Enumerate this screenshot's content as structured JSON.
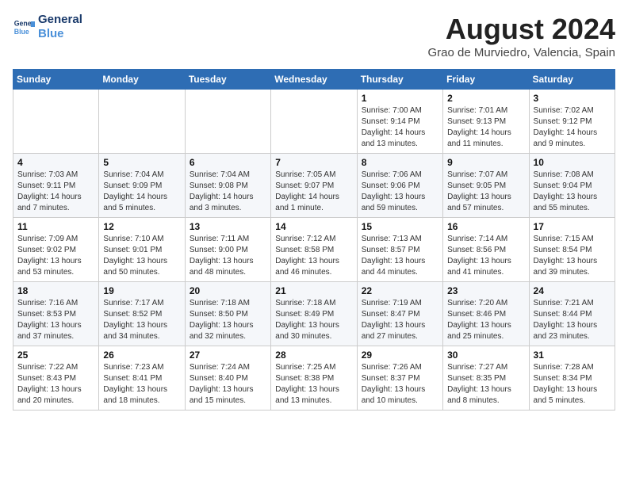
{
  "header": {
    "logo_line1": "General",
    "logo_line2": "Blue",
    "month": "August 2024",
    "location": "Grao de Murviedro, Valencia, Spain"
  },
  "weekdays": [
    "Sunday",
    "Monday",
    "Tuesday",
    "Wednesday",
    "Thursday",
    "Friday",
    "Saturday"
  ],
  "weeks": [
    [
      {
        "day": "",
        "info": ""
      },
      {
        "day": "",
        "info": ""
      },
      {
        "day": "",
        "info": ""
      },
      {
        "day": "",
        "info": ""
      },
      {
        "day": "1",
        "info": "Sunrise: 7:00 AM\nSunset: 9:14 PM\nDaylight: 14 hours\nand 13 minutes."
      },
      {
        "day": "2",
        "info": "Sunrise: 7:01 AM\nSunset: 9:13 PM\nDaylight: 14 hours\nand 11 minutes."
      },
      {
        "day": "3",
        "info": "Sunrise: 7:02 AM\nSunset: 9:12 PM\nDaylight: 14 hours\nand 9 minutes."
      }
    ],
    [
      {
        "day": "4",
        "info": "Sunrise: 7:03 AM\nSunset: 9:11 PM\nDaylight: 14 hours\nand 7 minutes."
      },
      {
        "day": "5",
        "info": "Sunrise: 7:04 AM\nSunset: 9:09 PM\nDaylight: 14 hours\nand 5 minutes."
      },
      {
        "day": "6",
        "info": "Sunrise: 7:04 AM\nSunset: 9:08 PM\nDaylight: 14 hours\nand 3 minutes."
      },
      {
        "day": "7",
        "info": "Sunrise: 7:05 AM\nSunset: 9:07 PM\nDaylight: 14 hours\nand 1 minute."
      },
      {
        "day": "8",
        "info": "Sunrise: 7:06 AM\nSunset: 9:06 PM\nDaylight: 13 hours\nand 59 minutes."
      },
      {
        "day": "9",
        "info": "Sunrise: 7:07 AM\nSunset: 9:05 PM\nDaylight: 13 hours\nand 57 minutes."
      },
      {
        "day": "10",
        "info": "Sunrise: 7:08 AM\nSunset: 9:04 PM\nDaylight: 13 hours\nand 55 minutes."
      }
    ],
    [
      {
        "day": "11",
        "info": "Sunrise: 7:09 AM\nSunset: 9:02 PM\nDaylight: 13 hours\nand 53 minutes."
      },
      {
        "day": "12",
        "info": "Sunrise: 7:10 AM\nSunset: 9:01 PM\nDaylight: 13 hours\nand 50 minutes."
      },
      {
        "day": "13",
        "info": "Sunrise: 7:11 AM\nSunset: 9:00 PM\nDaylight: 13 hours\nand 48 minutes."
      },
      {
        "day": "14",
        "info": "Sunrise: 7:12 AM\nSunset: 8:58 PM\nDaylight: 13 hours\nand 46 minutes."
      },
      {
        "day": "15",
        "info": "Sunrise: 7:13 AM\nSunset: 8:57 PM\nDaylight: 13 hours\nand 44 minutes."
      },
      {
        "day": "16",
        "info": "Sunrise: 7:14 AM\nSunset: 8:56 PM\nDaylight: 13 hours\nand 41 minutes."
      },
      {
        "day": "17",
        "info": "Sunrise: 7:15 AM\nSunset: 8:54 PM\nDaylight: 13 hours\nand 39 minutes."
      }
    ],
    [
      {
        "day": "18",
        "info": "Sunrise: 7:16 AM\nSunset: 8:53 PM\nDaylight: 13 hours\nand 37 minutes."
      },
      {
        "day": "19",
        "info": "Sunrise: 7:17 AM\nSunset: 8:52 PM\nDaylight: 13 hours\nand 34 minutes."
      },
      {
        "day": "20",
        "info": "Sunrise: 7:18 AM\nSunset: 8:50 PM\nDaylight: 13 hours\nand 32 minutes."
      },
      {
        "day": "21",
        "info": "Sunrise: 7:18 AM\nSunset: 8:49 PM\nDaylight: 13 hours\nand 30 minutes."
      },
      {
        "day": "22",
        "info": "Sunrise: 7:19 AM\nSunset: 8:47 PM\nDaylight: 13 hours\nand 27 minutes."
      },
      {
        "day": "23",
        "info": "Sunrise: 7:20 AM\nSunset: 8:46 PM\nDaylight: 13 hours\nand 25 minutes."
      },
      {
        "day": "24",
        "info": "Sunrise: 7:21 AM\nSunset: 8:44 PM\nDaylight: 13 hours\nand 23 minutes."
      }
    ],
    [
      {
        "day": "25",
        "info": "Sunrise: 7:22 AM\nSunset: 8:43 PM\nDaylight: 13 hours\nand 20 minutes."
      },
      {
        "day": "26",
        "info": "Sunrise: 7:23 AM\nSunset: 8:41 PM\nDaylight: 13 hours\nand 18 minutes."
      },
      {
        "day": "27",
        "info": "Sunrise: 7:24 AM\nSunset: 8:40 PM\nDaylight: 13 hours\nand 15 minutes."
      },
      {
        "day": "28",
        "info": "Sunrise: 7:25 AM\nSunset: 8:38 PM\nDaylight: 13 hours\nand 13 minutes."
      },
      {
        "day": "29",
        "info": "Sunrise: 7:26 AM\nSunset: 8:37 PM\nDaylight: 13 hours\nand 10 minutes."
      },
      {
        "day": "30",
        "info": "Sunrise: 7:27 AM\nSunset: 8:35 PM\nDaylight: 13 hours\nand 8 minutes."
      },
      {
        "day": "31",
        "info": "Sunrise: 7:28 AM\nSunset: 8:34 PM\nDaylight: 13 hours\nand 5 minutes."
      }
    ]
  ]
}
